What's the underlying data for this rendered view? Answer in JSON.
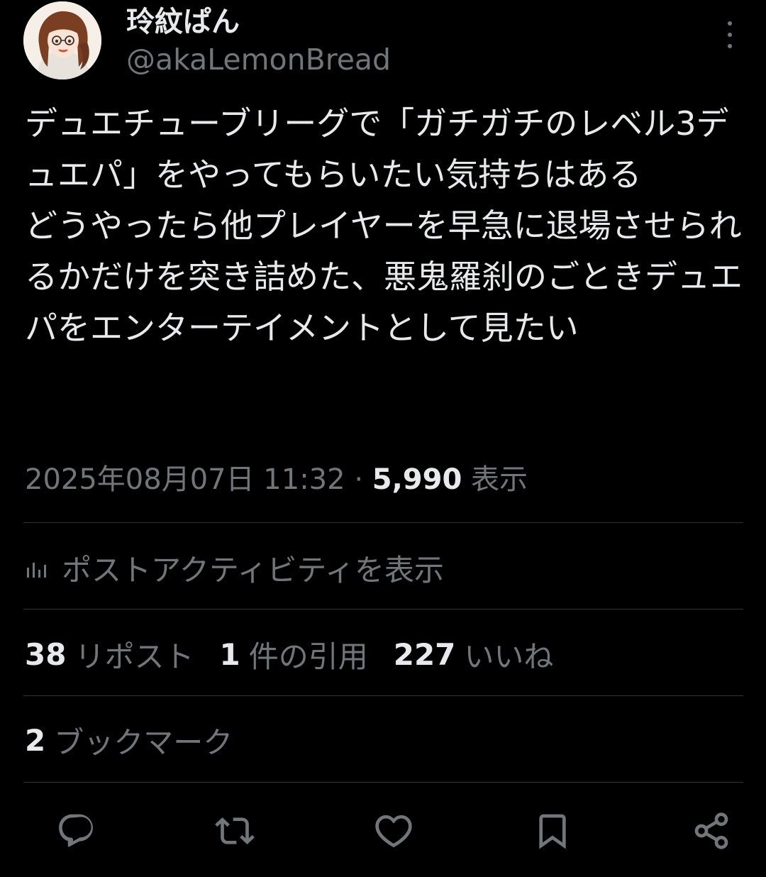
{
  "author": {
    "display_name": "玲紋ぱん",
    "handle": "@akaLemonBread",
    "avatar_icon": "avatar-anime-girl"
  },
  "tweet": {
    "text": "デュエチューブリーグで「ガチガチのレベル3デュエパ」をやってもらいたい気持ちはある\nどうやったら他プレイヤーを早急に退場させられるかだけを突き詰めた、悪鬼羅刹のごときデュエパをエンターテイメントとして見たい",
    "timestamp": "2025年08月07日 11:32",
    "separator": "·",
    "views_count": "5,990",
    "views_label": "表示"
  },
  "activity": {
    "label": "ポストアクティビティを表示",
    "icon": "bar-chart-icon"
  },
  "stats": [
    {
      "count": "38",
      "label": "リポスト"
    },
    {
      "count": "1",
      "label": "件の引用"
    },
    {
      "count": "227",
      "label": "いいね"
    }
  ],
  "bookmarks": {
    "count": "2",
    "label": "ブックマーク"
  },
  "actions": [
    "reply-icon",
    "retweet-icon",
    "like-icon",
    "bookmark-icon",
    "share-icon"
  ],
  "colors": {
    "background": "#000000",
    "primary_text": "#e7e9ea",
    "secondary_text": "#71767b",
    "divider": "#2f3336"
  }
}
